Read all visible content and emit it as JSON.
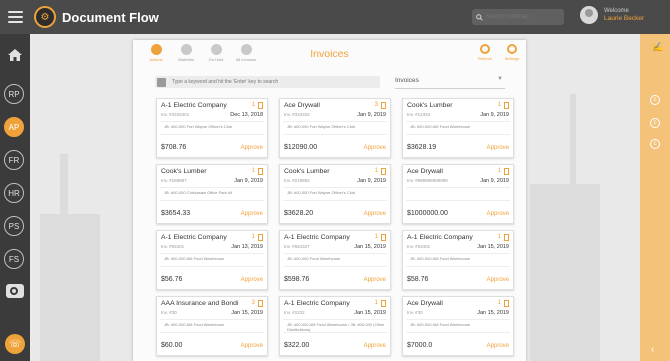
{
  "app": {
    "title": "Document Flow"
  },
  "header": {
    "search_placeholder": "Search Sitemap",
    "welcome": "Welcome",
    "user_name": "Laurie Becker"
  },
  "leftnav": {
    "items": [
      "RP",
      "AP",
      "FR",
      "HR",
      "PS",
      "FS"
    ],
    "active": "AP"
  },
  "panel": {
    "title": "Invoices",
    "tabs": [
      {
        "label": "Actions"
      },
      {
        "label": "Watchlist"
      },
      {
        "label": "On Hold"
      },
      {
        "label": "All Invoices"
      }
    ],
    "actions": {
      "refresh": "Refresh",
      "settings": "Settings"
    },
    "filter_placeholder": "Type a keyword and hit the 'Enter' key to search",
    "type_select": "Invoices"
  },
  "cards": [
    {
      "vendor": "A-1 Electric Company",
      "count": "1",
      "invoice": "Inv. #3333401",
      "date": "Dec 13, 2018",
      "job": "JB: #00-000 Fort Wayne Officer's Club",
      "amount": "$708.76",
      "approve": "Approve"
    },
    {
      "vendor": "Ace Drywall",
      "count": "3",
      "invoice": "Inv. #333333",
      "date": "Jan 9, 2019",
      "job": "JB: #00-000 Fort Wayne Officer's Club",
      "amount": "$12090.00",
      "approve": "Approve"
    },
    {
      "vendor": "Cook's Lumber",
      "count": "1",
      "invoice": "Inv. #12334",
      "date": "Jan 9, 2019",
      "job": "JB: #00-000 AM Food Warehouse",
      "amount": "$3628.19",
      "approve": "Approve"
    },
    {
      "vendor": "Cook's Lumber",
      "count": "1",
      "invoice": "Inv. #188887",
      "date": "Jan 9, 2019",
      "job": "JB: #00-000 Chickasaw Office Park #4",
      "amount": "$3654.33",
      "approve": "Approve"
    },
    {
      "vendor": "Cook's Lumber",
      "count": "1",
      "invoice": "Inv. #218883",
      "date": "Jan 9, 2019",
      "job": "JB: #00-000 Fort Wayne Officer's Club",
      "amount": "$3628.20",
      "approve": "Approve"
    },
    {
      "vendor": "Ace Drywall",
      "count": "1",
      "invoice": "Inv. #999999999999",
      "date": "Jan 9, 2019",
      "job": "",
      "amount": "$1000000.00",
      "approve": "Approve"
    },
    {
      "vendor": "A-1 Electric Company",
      "count": "1",
      "invoice": "Inv. #93401",
      "date": "Jan 13, 2019",
      "job": "JB: #00-000 AM Food Warehouse",
      "amount": "$56.76",
      "approve": "Approve"
    },
    {
      "vendor": "A-1 Electric Company",
      "count": "1",
      "invoice": "Inv. #564327",
      "date": "Jan 15, 2019",
      "job": "JB: #00-000 Food Warehouse",
      "amount": "$598.76",
      "approve": "Approve"
    },
    {
      "vendor": "A-1 Electric Company",
      "count": "1",
      "invoice": "Inv. #63401",
      "date": "Jan 15, 2019",
      "job": "JB: #00-000 AM Food Warehouse",
      "amount": "$58.76",
      "approve": "Approve"
    },
    {
      "vendor": "AAA Insurance and Bondin",
      "count": "3",
      "invoice": "Inv. #30",
      "date": "Jan 15, 2019",
      "job": "JB: #00-000 AM Food Warehouse",
      "amount": "$60.00",
      "approve": "Approve"
    },
    {
      "vendor": "A-1 Electric Company",
      "count": "1",
      "invoice": "Inv. #2222",
      "date": "Jan 15, 2019",
      "job": "JB: #00-000 AM Food Warehouse / JB: #00-000 (Other Distributions)",
      "amount": "$322.00",
      "approve": "Approve"
    },
    {
      "vendor": "Ace Drywall",
      "count": "1",
      "invoice": "Inv. #30",
      "date": "Jan 15, 2019",
      "job": "JB: #00-000 AM Food Warehouse",
      "amount": "$7000.0",
      "approve": "Approve"
    }
  ],
  "colors": {
    "accent": "#f0a23a",
    "topbar": "#4a4a4a",
    "sidebar": "#3b3b3b",
    "rightbar": "#f5c27a"
  }
}
